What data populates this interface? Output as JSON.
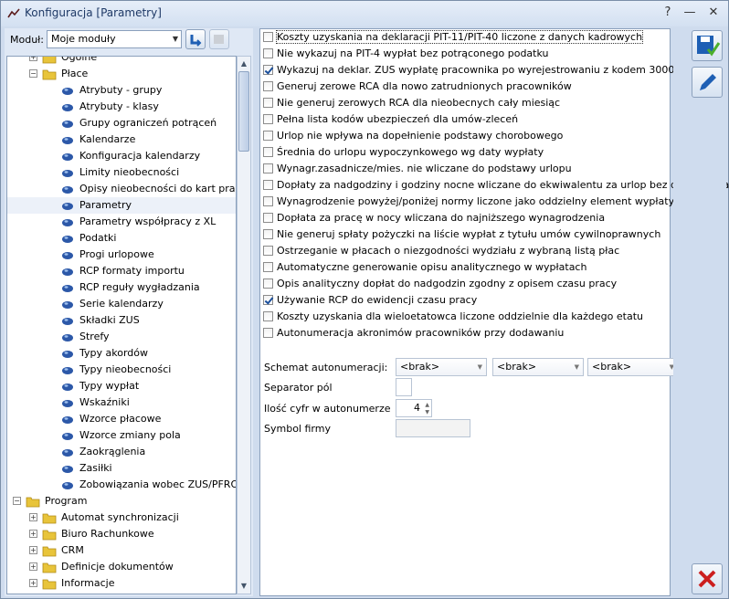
{
  "window": {
    "title": "Konfiguracja [Parametry]"
  },
  "toolbar": {
    "modul_label": "Moduł:",
    "modul_value": "Moje moduły"
  },
  "tree": [
    {
      "label": "Ogólne",
      "level": 1,
      "type": "folder",
      "expander": "+"
    },
    {
      "label": "Płace",
      "level": 1,
      "type": "folder",
      "expander": "-"
    },
    {
      "label": "Atrybuty - grupy",
      "level": 2,
      "type": "leaf"
    },
    {
      "label": "Atrybuty - klasy",
      "level": 2,
      "type": "leaf"
    },
    {
      "label": "Grupy ograniczeń potrąceń",
      "level": 2,
      "type": "leaf"
    },
    {
      "label": "Kalendarze",
      "level": 2,
      "type": "leaf"
    },
    {
      "label": "Konfiguracja kalendarzy",
      "level": 2,
      "type": "leaf"
    },
    {
      "label": "Limity nieobecności",
      "level": 2,
      "type": "leaf"
    },
    {
      "label": "Opisy nieobecności do kart pracy",
      "level": 2,
      "type": "leaf"
    },
    {
      "label": "Parametry",
      "level": 2,
      "type": "leaf",
      "selected": true
    },
    {
      "label": "Parametry współpracy z XL",
      "level": 2,
      "type": "leaf"
    },
    {
      "label": "Podatki",
      "level": 2,
      "type": "leaf"
    },
    {
      "label": "Progi urlopowe",
      "level": 2,
      "type": "leaf"
    },
    {
      "label": "RCP formaty importu",
      "level": 2,
      "type": "leaf"
    },
    {
      "label": "RCP reguły wygładzania",
      "level": 2,
      "type": "leaf"
    },
    {
      "label": "Serie kalendarzy",
      "level": 2,
      "type": "leaf"
    },
    {
      "label": "Składki ZUS",
      "level": 2,
      "type": "leaf"
    },
    {
      "label": "Strefy",
      "level": 2,
      "type": "leaf"
    },
    {
      "label": "Typy akordów",
      "level": 2,
      "type": "leaf"
    },
    {
      "label": "Typy nieobecności",
      "level": 2,
      "type": "leaf"
    },
    {
      "label": "Typy wypłat",
      "level": 2,
      "type": "leaf"
    },
    {
      "label": "Wskaźniki",
      "level": 2,
      "type": "leaf"
    },
    {
      "label": "Wzorce płacowe",
      "level": 2,
      "type": "leaf"
    },
    {
      "label": "Wzorce zmiany pola",
      "level": 2,
      "type": "leaf"
    },
    {
      "label": "Zaokrąglenia",
      "level": 2,
      "type": "leaf"
    },
    {
      "label": "Zasiłki",
      "level": 2,
      "type": "leaf"
    },
    {
      "label": "Zobowiązania wobec ZUS/PFRON",
      "level": 2,
      "type": "leaf"
    },
    {
      "label": "Program",
      "level": 0,
      "type": "folder",
      "expander": "-"
    },
    {
      "label": "Automat synchronizacji",
      "level": 1,
      "type": "folder",
      "expander": "+"
    },
    {
      "label": "Biuro Rachunkowe",
      "level": 1,
      "type": "folder",
      "expander": "+"
    },
    {
      "label": "CRM",
      "level": 1,
      "type": "folder",
      "expander": "+"
    },
    {
      "label": "Definicje dokumentów",
      "level": 1,
      "type": "folder",
      "expander": "+"
    },
    {
      "label": "Informacje",
      "level": 1,
      "type": "folder",
      "expander": "+"
    }
  ],
  "options": [
    {
      "label": "Koszty uzyskania na deklaracji PIT-11/PIT-40 liczone z danych kadrowych",
      "checked": false,
      "focus": true
    },
    {
      "label": "Nie wykazuj na PIT-4 wypłat bez potrąconego podatku",
      "checked": false
    },
    {
      "label": "Wykazuj na deklar. ZUS wypłatę pracownika po wyrejestrowaniu z kodem 3000.",
      "checked": true
    },
    {
      "label": "Generuj zerowe RCA dla nowo zatrudnionych pracowników",
      "checked": false
    },
    {
      "label": "Nie generuj zerowych RCA dla nieobecnych cały miesiąc",
      "checked": false
    },
    {
      "label": "Pełna lista kodów ubezpieczeń dla umów-zleceń",
      "checked": false
    },
    {
      "label": "Urlop nie wpływa na dopełnienie podstawy chorobowego",
      "checked": false
    },
    {
      "label": "Średnia do urlopu wypoczynkowego wg daty wypłaty",
      "checked": false
    },
    {
      "label": "Wynagr.zasadnicze/mies. nie wliczane do podstawy urlopu",
      "checked": false
    },
    {
      "label": "Dopłaty za nadgodziny i godziny nocne wliczane do ekwiwalentu za urlop bez dopełnienia",
      "checked": false
    },
    {
      "label": "Wynagrodzenie powyżej/poniżej normy liczone jako oddzielny element wypłaty",
      "checked": false
    },
    {
      "label": "Dopłata za pracę w nocy wliczana do najniższego wynagrodzenia",
      "checked": false
    },
    {
      "label": "Nie generuj spłaty pożyczki na liście wypłat z tytułu umów cywilnoprawnych",
      "checked": false
    },
    {
      "label": "Ostrzeganie w płacach o niezgodności wydziału z wybraną listą płac",
      "checked": false
    },
    {
      "label": "Automatyczne generowanie opisu analitycznego w wypłatach",
      "checked": false
    },
    {
      "label": "Opis analityczny dopłat do nadgodzin zgodny z opisem czasu pracy",
      "checked": false
    },
    {
      "label": "Używanie RCP do ewidencji czasu pracy",
      "checked": true
    },
    {
      "label": "Koszty uzyskania dla wieloetatowca liczone oddzielnie dla każdego etatu",
      "checked": false
    },
    {
      "label": "Autonumeracja akronimów pracowników przy dodawaniu",
      "checked": false
    }
  ],
  "form": {
    "schemat_label": "Schemat autonumeracji:",
    "schemat_values": [
      "<brak>",
      "<brak>",
      "<brak>"
    ],
    "separator_label": "Separator pól",
    "cyfry_label": "Ilość cyfr w autonumerze",
    "cyfry_value": "4",
    "symbol_label": "Symbol firmy"
  },
  "colors": {
    "save": "#1e5fb4",
    "cancel": "#cc1f1f",
    "folder": "#e8c43a"
  }
}
